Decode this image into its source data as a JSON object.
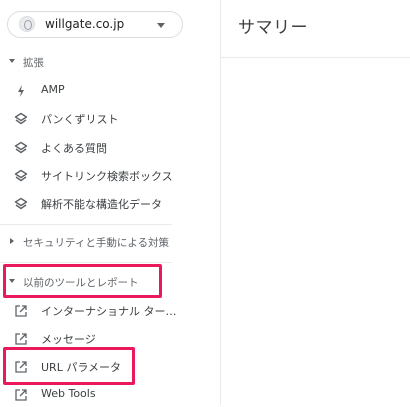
{
  "property": {
    "name": "willgate.co.jp"
  },
  "main": {
    "title": "サマリー"
  },
  "sections": {
    "enhancements": {
      "label": "拡張",
      "items": [
        {
          "label": "AMP",
          "icon": "lightning-icon"
        },
        {
          "label": "パンくずリスト",
          "icon": "layers-icon"
        },
        {
          "label": "よくある質問",
          "icon": "layers-icon"
        },
        {
          "label": "サイトリンク検索ボックス",
          "icon": "layers-icon"
        },
        {
          "label": "解析不能な構造化データ",
          "icon": "layers-icon"
        }
      ]
    },
    "security": {
      "label": "セキュリティと手動による対策"
    },
    "legacy": {
      "label": "以前のツールとレポート",
      "items": [
        {
          "label": "インターナショナル ター…",
          "icon": "open-external-icon"
        },
        {
          "label": "メッセージ",
          "icon": "open-external-icon"
        },
        {
          "label": "URL パラメータ",
          "icon": "open-external-icon"
        },
        {
          "label": "Web Tools",
          "icon": "open-external-icon"
        }
      ]
    }
  },
  "colors": {
    "highlight": "#e9195c",
    "sidebar_text": "#3c4043",
    "section_text": "#5f6368"
  }
}
